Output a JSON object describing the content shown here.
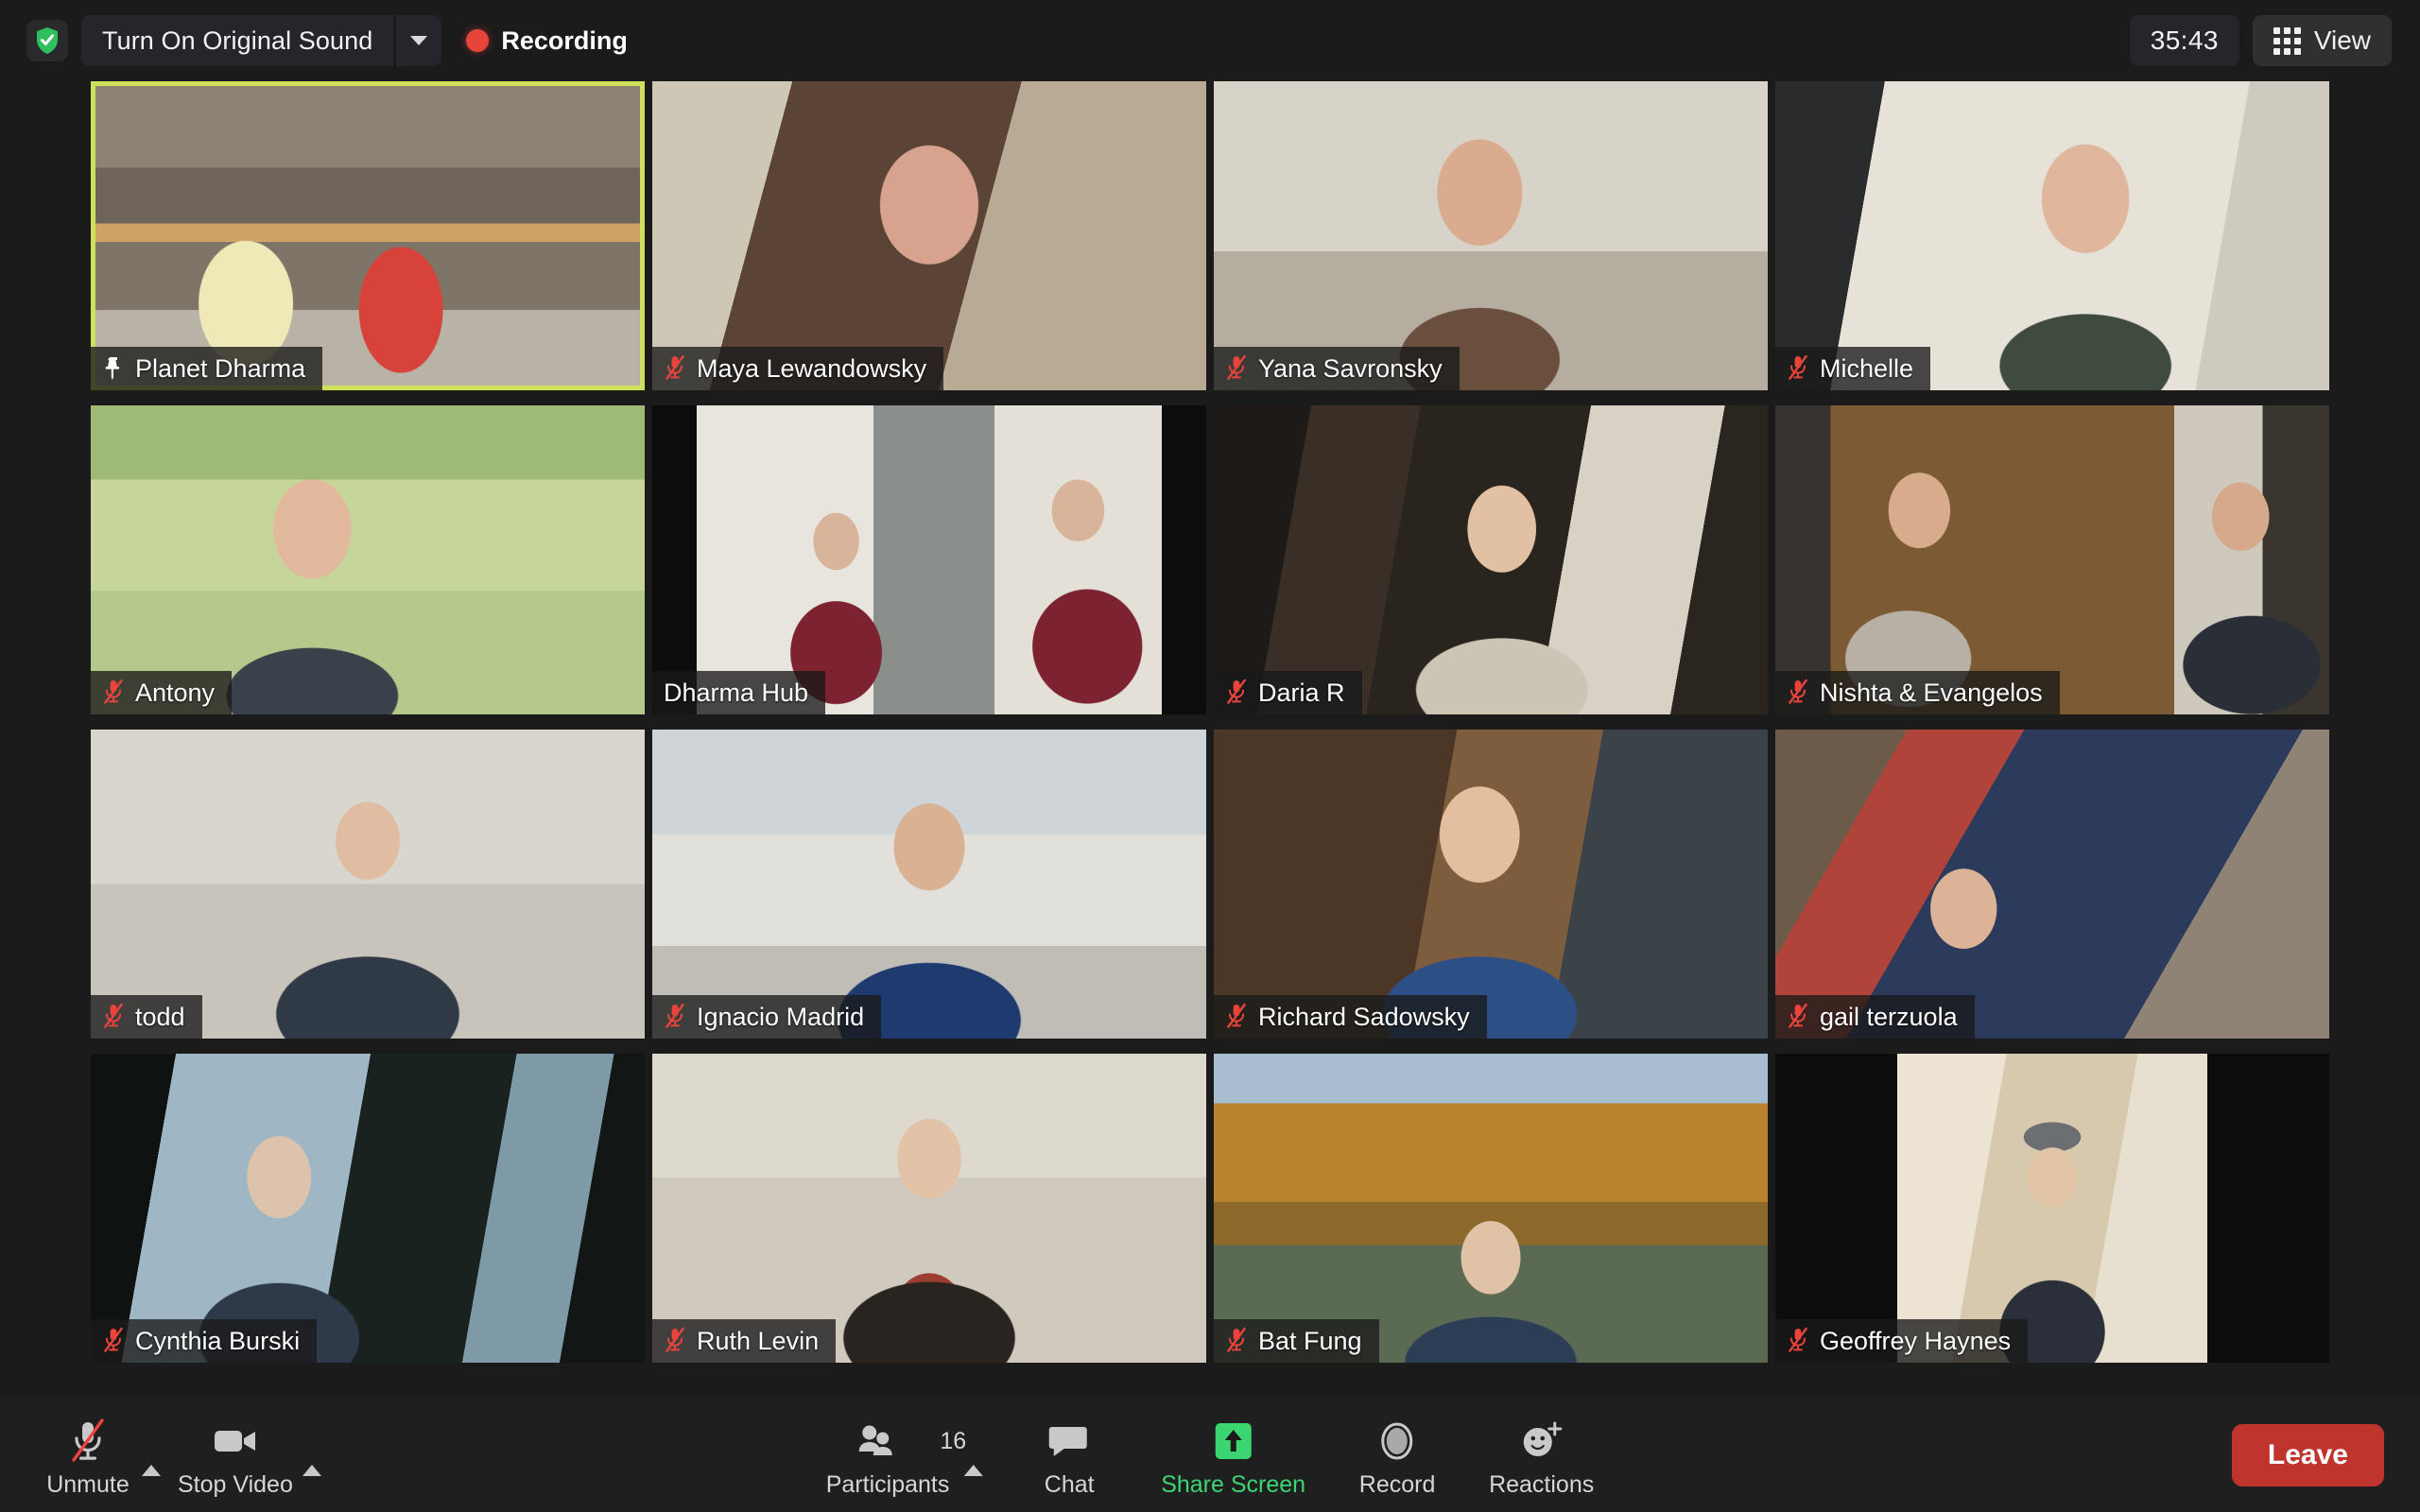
{
  "topbar": {
    "security_icon": "shield-check-icon",
    "original_sound_label": "Turn On Original Sound",
    "dropdown_icon": "chevron-down-icon",
    "recording_label": "Recording",
    "recording_dot_color": "#e8443c",
    "timer": "35:43",
    "view_label": "View",
    "view_icon": "grid-icon"
  },
  "gallery": {
    "rows": [
      [
        {
          "name": "Planet Dharma",
          "muted": false,
          "pinned": true,
          "active_speaker": true,
          "style": "pd",
          "letterbox": "none"
        },
        {
          "name": "Maya Lewandowsky",
          "muted": true,
          "pinned": false,
          "active_speaker": false,
          "style": "maya",
          "letterbox": "none"
        },
        {
          "name": "Yana Savronsky",
          "muted": true,
          "pinned": false,
          "active_speaker": false,
          "style": "yana",
          "letterbox": "none"
        },
        {
          "name": "Michelle",
          "muted": true,
          "pinned": false,
          "active_speaker": false,
          "style": "michelle",
          "letterbox": "none"
        }
      ],
      [
        {
          "name": "Antony",
          "muted": true,
          "pinned": false,
          "active_speaker": false,
          "style": "antony",
          "letterbox": "none"
        },
        {
          "name": "Dharma Hub",
          "muted": false,
          "pinned": false,
          "active_speaker": false,
          "style": "dharmahub",
          "letterbox": "small"
        },
        {
          "name": "Daria R",
          "muted": true,
          "pinned": false,
          "active_speaker": false,
          "style": "daria",
          "letterbox": "none"
        },
        {
          "name": "Nishta & Evangelos",
          "muted": true,
          "pinned": false,
          "active_speaker": false,
          "style": "nishta",
          "letterbox": "none"
        }
      ],
      [
        {
          "name": "todd",
          "muted": true,
          "pinned": false,
          "active_speaker": false,
          "style": "todd",
          "letterbox": "none"
        },
        {
          "name": "Ignacio Madrid",
          "muted": true,
          "pinned": false,
          "active_speaker": false,
          "style": "ignacio",
          "letterbox": "none"
        },
        {
          "name": "Richard Sadowsky",
          "muted": true,
          "pinned": false,
          "active_speaker": false,
          "style": "richard",
          "letterbox": "none"
        },
        {
          "name": "gail terzuola",
          "muted": true,
          "pinned": false,
          "active_speaker": false,
          "style": "gail",
          "letterbox": "none"
        }
      ],
      [
        {
          "name": "Cynthia Burski",
          "muted": true,
          "pinned": false,
          "active_speaker": false,
          "style": "cynthia",
          "letterbox": "none"
        },
        {
          "name": "Ruth Levin",
          "muted": true,
          "pinned": false,
          "active_speaker": false,
          "style": "ruth",
          "letterbox": "none"
        },
        {
          "name": "Bat Fung",
          "muted": true,
          "pinned": false,
          "active_speaker": false,
          "style": "bat",
          "letterbox": "none"
        },
        {
          "name": "Geoffrey Haynes",
          "muted": true,
          "pinned": false,
          "active_speaker": false,
          "style": "geoffrey",
          "letterbox": "large"
        }
      ]
    ]
  },
  "toolbar": {
    "unmute_label": "Unmute",
    "unmute_icon": "microphone-muted-icon",
    "stop_video_label": "Stop Video",
    "stop_video_icon": "camera-icon",
    "participants_label": "Participants",
    "participants_icon": "people-icon",
    "participants_count": "16",
    "chat_label": "Chat",
    "chat_icon": "speech-bubble-icon",
    "share_screen_label": "Share Screen",
    "share_screen_icon": "share-arrow-up-icon",
    "share_screen_color": "#3bd671",
    "record_label": "Record",
    "record_icon": "record-circle-icon",
    "reactions_label": "Reactions",
    "reactions_icon": "smiley-plus-icon",
    "leave_label": "Leave",
    "leave_color": "#c0342e",
    "caret_icon": "chevron-up-icon"
  }
}
